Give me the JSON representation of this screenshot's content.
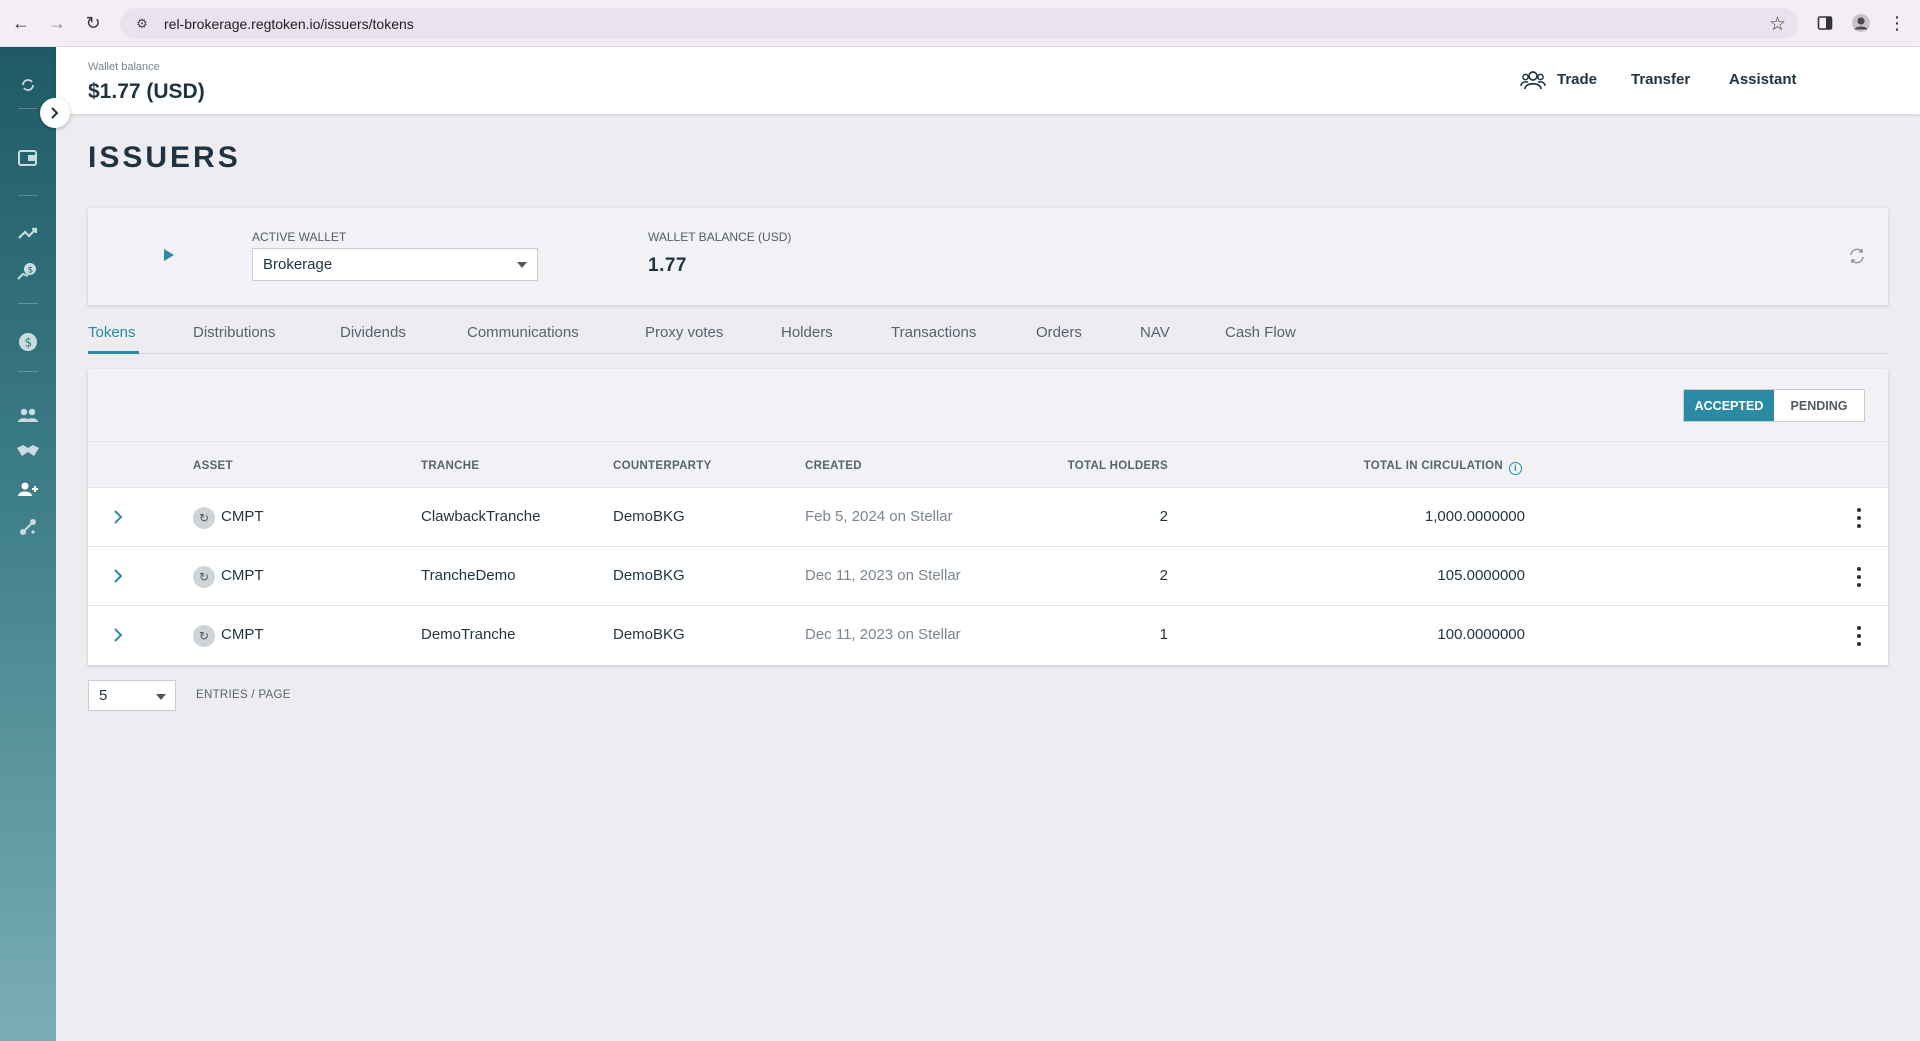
{
  "browser": {
    "url": "rel-brokerage.regtoken.io/issuers/tokens"
  },
  "header": {
    "wallet_balance_label": "Wallet balance",
    "wallet_balance_value": "$1.77 (USD)",
    "links": [
      "Trade",
      "Transfer",
      "Assistant"
    ]
  },
  "page": {
    "title": "ISSUERS"
  },
  "wallet_card": {
    "active_wallet_label": "ACTIVE WALLET",
    "active_wallet_value": "Brokerage",
    "balance_label": "WALLET BALANCE (USD)",
    "balance_value": "1.77"
  },
  "tabs": [
    "Tokens",
    "Distributions",
    "Dividends",
    "Communications",
    "Proxy votes",
    "Holders",
    "Transactions",
    "Orders",
    "NAV",
    "Cash Flow"
  ],
  "active_tab": "Tokens",
  "filter": {
    "accepted_label": "ACCEPTED",
    "pending_label": "PENDING",
    "selected": "ACCEPTED"
  },
  "table": {
    "columns": [
      "ASSET",
      "TRANCHE",
      "COUNTERPARTY",
      "CREATED",
      "TOTAL HOLDERS",
      "TOTAL IN CIRCULATION"
    ],
    "rows": [
      {
        "asset": "CMPT",
        "tranche": "ClawbackTranche",
        "counterparty": "DemoBKG",
        "created": "Feb 5, 2024 on Stellar",
        "holders": "2",
        "circulation": "1,000.0000000"
      },
      {
        "asset": "CMPT",
        "tranche": "TrancheDemo",
        "counterparty": "DemoBKG",
        "created": "Dec 11, 2023 on Stellar",
        "holders": "2",
        "circulation": "105.0000000"
      },
      {
        "asset": "CMPT",
        "tranche": "DemoTranche",
        "counterparty": "DemoBKG",
        "created": "Dec 11, 2023 on Stellar",
        "holders": "1",
        "circulation": "100.0000000"
      }
    ]
  },
  "pager": {
    "page_size": "5",
    "label": "ENTRIES / PAGE"
  },
  "colors": {
    "accent": "#2b8ba4",
    "text": "#1f3340",
    "sidebar_top": "#1f5a66",
    "sidebar_bottom": "#7aaeb4"
  }
}
